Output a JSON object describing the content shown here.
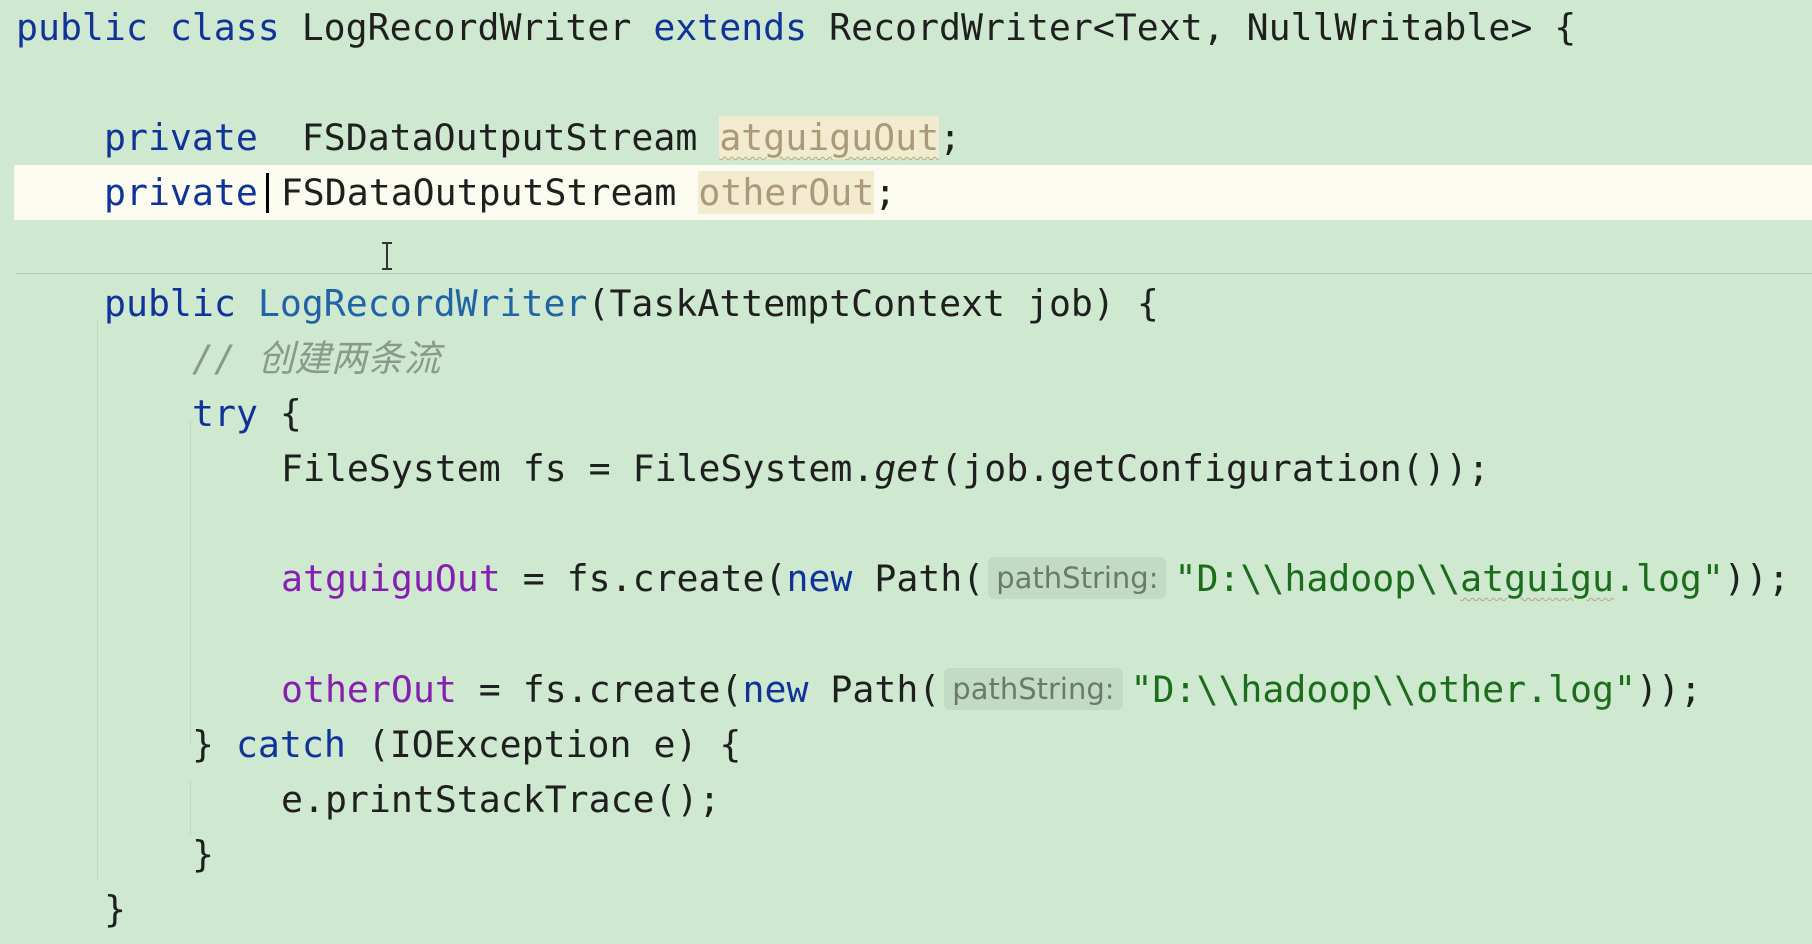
{
  "editor": {
    "class_decl": {
      "kw_public": "public",
      "kw_class": "class",
      "class_name": "LogRecordWriter",
      "kw_extends": "extends",
      "super_type": "RecordWriter<Text, NullWritable>",
      "brace": " {"
    },
    "field1": {
      "kw_private": "private",
      "type": "FSDataOutputStream",
      "name": "atguiguOut",
      "semi": ";"
    },
    "field2": {
      "kw_private": "private",
      "type": "FSDataOutputStream",
      "name": "otherOut",
      "semi": ";"
    },
    "ctor": {
      "kw_public": "public",
      "name": "LogRecordWriter",
      "params": "(TaskAttemptContext job) {"
    },
    "comment": "// 创建两条流",
    "try_kw": "try",
    "try_brace": " {",
    "fs_line": {
      "decl": "FileSystem fs = FileSystem.",
      "get": "get",
      "rest": "(job.getConfiguration());"
    },
    "create1": {
      "target": "atguiguOut",
      "assign": " = fs.create(",
      "kw_new": "new",
      "path": " Path(",
      "hint": "pathString:",
      "str_start": "\"D:\\\\hadoop\\\\",
      "str_squig": "atguigu",
      "str_end": ".log\"",
      "close": "));"
    },
    "create2": {
      "target": "otherOut",
      "assign": " = fs.create(",
      "kw_new": "new",
      "path": " Path(",
      "hint": "pathString:",
      "str": "\"D:\\\\hadoop\\\\other.log\"",
      "close": "));"
    },
    "catch_line": {
      "close_brace": "} ",
      "kw_catch": "catch",
      "rest": " (IOException e) {"
    },
    "print_stack": "e.printStackTrace();",
    "close_inner": "}",
    "close_ctor": "}"
  },
  "colors": {
    "background": "#cfe8d0",
    "keyword": "#10339a",
    "field": "#861eb0",
    "string": "#1b6d1b",
    "comment": "#8a9a8a",
    "current_line": "#fcfbef"
  }
}
